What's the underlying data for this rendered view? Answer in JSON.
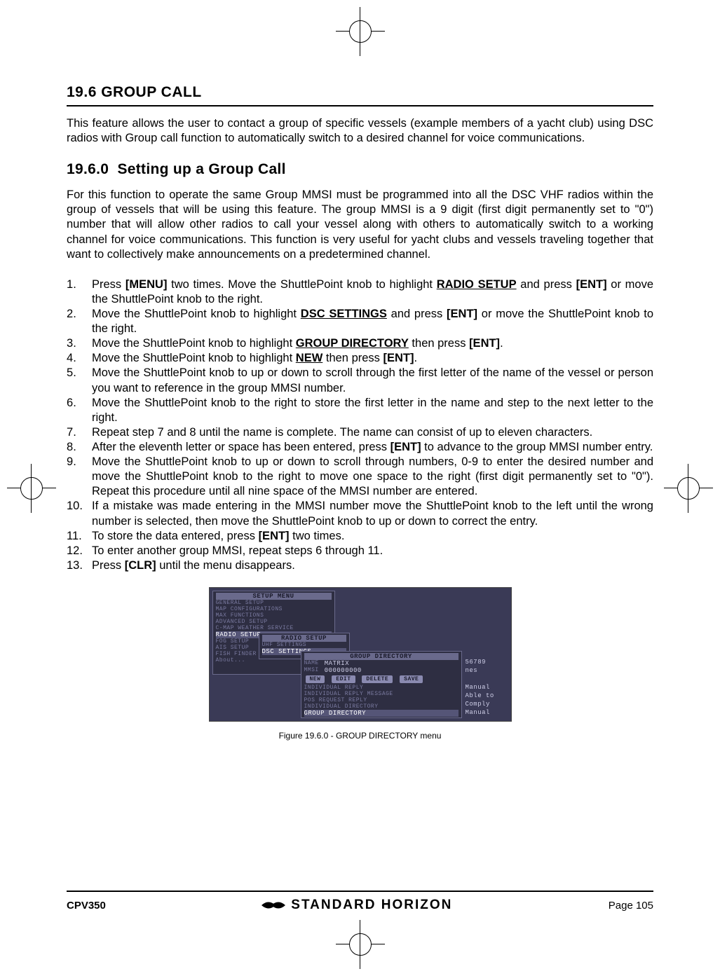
{
  "header": {
    "section_number": "19.6",
    "section_title": "GROUP CALL"
  },
  "intro": "This feature allows the user to contact a group of specific vessels (example members of a yacht club) using DSC radios with Group call function to automatically switch to a desired channel for voice communications.",
  "subsection": {
    "number": "19.6.0",
    "title": "Setting up a Group Call"
  },
  "subsection_intro": "For this function to operate the same Group MMSI must be programmed into all the DSC VHF radios within the group of vessels that will be using this feature. The group MMSI is a 9 digit (first digit permanently set to \"0\") number that will allow other radios to call your vessel along with others to automatically switch to a working channel for voice communications. This function is very useful for yacht clubs and vessels traveling together that want to collectively make announcements on a predetermined channel.",
  "steps": [
    {
      "pre": "Press ",
      "b1": "[MENU]",
      "mid": " two times. Move the ShuttlePoint knob to highlight ",
      "u": "RADIO SETUP",
      "post": " and press ",
      "b2": "[ENT]",
      "tail": " or move the ShuttlePoint knob to the right."
    },
    {
      "pre": "Move the ShuttlePoint knob to highlight ",
      "u": "DSC SETTINGS",
      "mid": " and press ",
      "b1": "[ENT]",
      "tail": " or move the ShuttlePoint knob to the right."
    },
    {
      "pre": "Move the ShuttlePoint knob to highlight ",
      "u": "GROUP DIRECTORY",
      "mid": " then press ",
      "b1": "[ENT]",
      "tail": "."
    },
    {
      "pre": "Move the ShuttlePoint knob to highlight ",
      "u": "NEW",
      "mid": " then press ",
      "b1": "[ENT]",
      "tail": "."
    },
    {
      "text": "Move the ShuttlePoint knob to up or down to scroll through the first letter of the name of the vessel or person you want to reference in the group MMSI number."
    },
    {
      "text": "Move the ShuttlePoint knob to the right to store the first letter in the name and step to the next letter to the right."
    },
    {
      "text": "Repeat step 7 and 8 until the name is complete. The name can consist of up to eleven characters."
    },
    {
      "pre": "After the eleventh letter or space has been entered, press ",
      "b1": "[ENT]",
      "tail": " to advance to the group MMSI number entry."
    },
    {
      "text": "Move the ShuttlePoint knob to up or down to scroll through numbers, 0-9 to enter the desired number and move the ShuttlePoint knob to the right to move one space to the right (first digit permanently set to \"0\"). Repeat this procedure until all nine space of the MMSI number are entered."
    },
    {
      "text": "If a mistake was made entering in the MMSI number move the ShuttlePoint knob to the left until the wrong number is selected, then move the ShuttlePoint knob to up or down to correct the entry."
    },
    {
      "pre": "To store the data entered, press ",
      "b1": "[ENT]",
      "tail": " two times."
    },
    {
      "text": "To enter another group MMSI, repeat steps 6 through 11."
    },
    {
      "pre": "Press ",
      "b1": "[CLR]",
      "tail": " until the menu disappears."
    }
  ],
  "figure": {
    "caption": "Figure 19.6.0 - GROUP DIRECTORY menu",
    "panels": {
      "setup_menu_title": "SETUP MENU",
      "setup_items": [
        "GENERAL SETUP",
        "MAP CONFIGURATIONS",
        "MAX FUNCTIONS",
        "ADVANCED SETUP",
        "C-MAP WEATHER SERVICE",
        "RADIO SETUP",
        "FOG SETUP",
        "AIS SETUP",
        "FISH FINDER SETUP",
        "About..."
      ],
      "radio_setup_title": "RADIO SETUP",
      "radio_items": [
        "UHF SETTINGS",
        "DSC SETTINGS"
      ],
      "group_dir_title": "GROUP DIRECTORY",
      "group_name_label": "NAME",
      "group_name_value": "MATRIX",
      "group_mmsi_label": "MMSI",
      "group_mmsi_value": "000000000",
      "buttons": [
        "NEW",
        "EDIT",
        "DELETE",
        "SAVE"
      ],
      "lower_items": [
        "INDIVIDUAL REPLY",
        "INDIVIDUAL REPLY MESSAGE",
        "POS REQUEST REPLY",
        "INDIVIDUAL DIRECTORY",
        "GROUP DIRECTORY"
      ],
      "right_values": [
        "56789",
        "nes",
        "Manual",
        "Able to Comply",
        "Manual"
      ]
    }
  },
  "footer": {
    "model": "CPV350",
    "brand": "STANDARD HORIZON",
    "page": "Page 105"
  }
}
